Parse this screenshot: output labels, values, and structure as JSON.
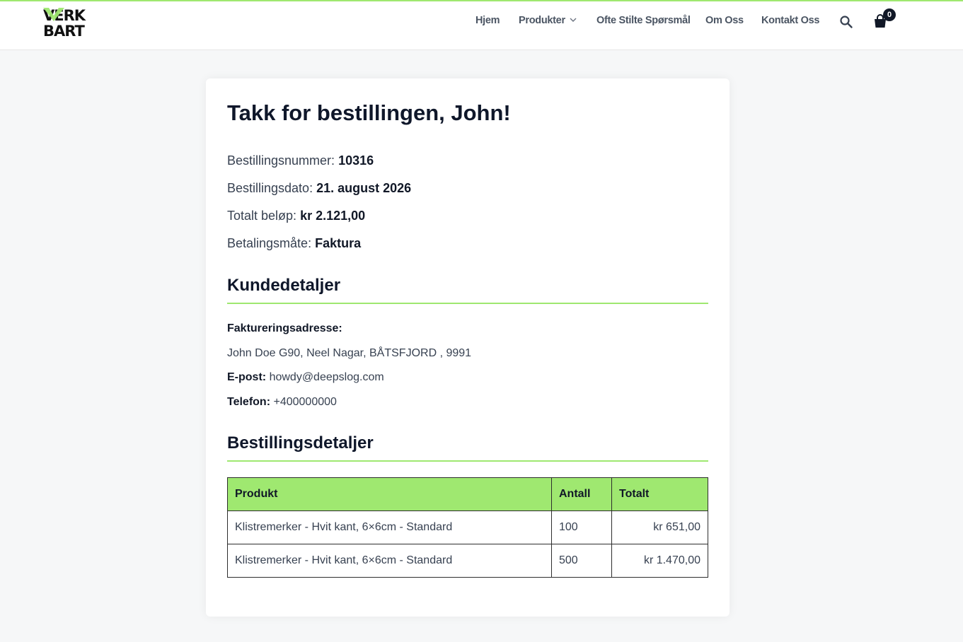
{
  "brand": {
    "logo_text_line1": "VERK",
    "logo_text_line2": "BART",
    "accent_color": "#9fe870"
  },
  "nav": {
    "items": [
      {
        "label": "Hjem"
      },
      {
        "label": "Produkter",
        "has_dropdown": true
      },
      {
        "label": "Ofte Stilte Spørsmål"
      },
      {
        "label": "Om Oss"
      },
      {
        "label": "Kontakt Oss"
      }
    ],
    "search_icon": "search-icon",
    "cart_icon": "cart-icon",
    "cart_count": "0"
  },
  "order": {
    "title": "Takk for bestillingen, John!",
    "number_label": "Bestillingsnummer:",
    "number_value": "10316",
    "date_label": "Bestillingsdato:",
    "date_value": "21. august 2026",
    "total_label": "Totalt beløp:",
    "total_value": "kr 2.121,00",
    "payment_label": "Betalingsmåte:",
    "payment_value": "Faktura"
  },
  "customer": {
    "heading": "Kundedetaljer",
    "billing_label": "Faktureringsadresse:",
    "address": "John Doe G90, Neel Nagar, BÅTSFJORD , 9991",
    "email_label": "E-post:",
    "email_value": "howdy@deepslog.com",
    "phone_label": "Telefon:",
    "phone_value": "+400000000"
  },
  "details": {
    "heading": "Bestillingsdetaljer",
    "columns": [
      "Produkt",
      "Antall",
      "Totalt"
    ],
    "rows": [
      {
        "product": "Klistremerker - Hvit kant, 6×6cm - Standard",
        "qty": "100",
        "total": "kr 651,00"
      },
      {
        "product": "Klistremerker - Hvit kant, 6×6cm - Standard",
        "qty": "500",
        "total": "kr 1.470,00"
      }
    ]
  }
}
